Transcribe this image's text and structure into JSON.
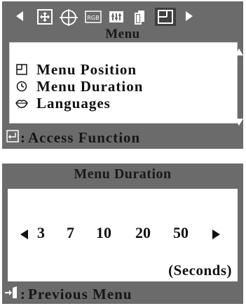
{
  "menu_panel": {
    "title": "Menu",
    "tabs": [
      {
        "icon": "position-arrows-icon"
      },
      {
        "icon": "globe-icon"
      },
      {
        "icon": "rgb-icon",
        "text": "RGB"
      },
      {
        "icon": "bars-icon"
      },
      {
        "icon": "pages-icon"
      },
      {
        "icon": "menu-window-icon",
        "selected": true
      }
    ],
    "items": [
      {
        "label": "Menu Position",
        "icon": "menu-position-icon"
      },
      {
        "label": "Menu Duration",
        "icon": "clock-icon"
      },
      {
        "label": "Languages",
        "icon": "lips-icon"
      }
    ],
    "footer": {
      "icon": "enter-icon",
      "label": "Access Function"
    }
  },
  "duration_panel": {
    "title": "Menu Duration",
    "values": [
      "3",
      "7",
      "10",
      "20",
      "50"
    ],
    "units": "(Seconds)",
    "footer": {
      "icon": "exit-icon",
      "label": "Previous Menu"
    }
  },
  "colors": {
    "panel_bg": "#6b6b6b",
    "box_bg": "#ffffff",
    "text": "#111111",
    "selected_tab": "#3f3f3f"
  }
}
